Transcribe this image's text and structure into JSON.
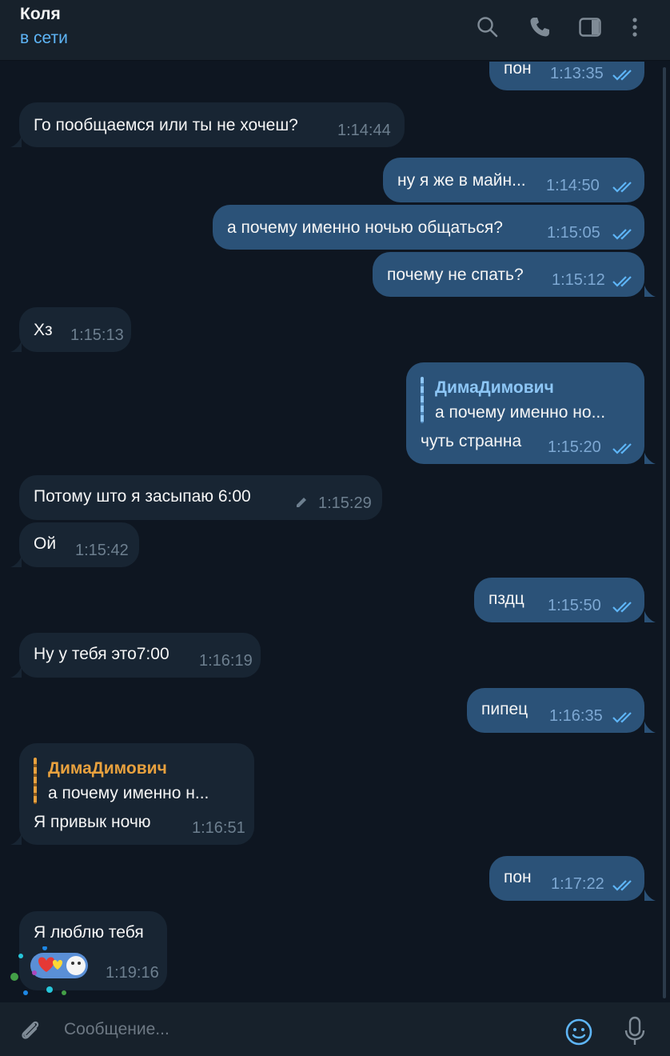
{
  "header": {
    "contact_name": "Коля",
    "status": "в сети",
    "icons": [
      "search-icon",
      "phone-icon",
      "sidebar-toggle-icon",
      "more-vertical-icon"
    ]
  },
  "messages": [
    {
      "dir": "out",
      "text": "пон",
      "time": "1:13:35",
      "read": true
    },
    {
      "dir": "in",
      "text": "Го пообщаемся или ты не хочеш?",
      "time": "1:14:44"
    },
    {
      "dir": "out",
      "text": "ну я же в майн...",
      "time": "1:14:50",
      "read": true
    },
    {
      "dir": "out",
      "text": "а почему именно ночью общаться?",
      "time": "1:15:05",
      "read": true
    },
    {
      "dir": "out",
      "text": "почему не спать?",
      "time": "1:15:12",
      "read": true
    },
    {
      "dir": "in",
      "text": "Хз",
      "time": "1:15:13"
    },
    {
      "dir": "out",
      "reply": {
        "name": "ДимаДимович",
        "text": "а почему именно но..."
      },
      "text": "чуть странна",
      "time": "1:15:20",
      "read": true
    },
    {
      "dir": "in",
      "text": "Потому што я засыпаю 6:00",
      "time": "1:15:29",
      "edited_icon": "pencil-icon"
    },
    {
      "dir": "in",
      "text": "Ой",
      "time": "1:15:42"
    },
    {
      "dir": "out",
      "text": "пздц",
      "time": "1:15:50",
      "read": true
    },
    {
      "dir": "in",
      "text": "Ну у тебя это7:00",
      "time": "1:16:19"
    },
    {
      "dir": "out",
      "text": "пипец",
      "time": "1:16:35",
      "read": true
    },
    {
      "dir": "in",
      "reply": {
        "name": "ДимаДимович",
        "text": "а почему именно н..."
      },
      "text": "Я привык ночю",
      "time": "1:16:51"
    },
    {
      "dir": "out",
      "text": "пон",
      "time": "1:17:22",
      "read": true
    },
    {
      "dir": "in",
      "text": "Я люблю тебя",
      "sticker": "hearts-sticker",
      "time": "1:19:16"
    }
  ],
  "composer": {
    "placeholder": "Сообщение...",
    "icons": [
      "attach-icon",
      "emoji-icon",
      "microphone-icon"
    ]
  },
  "colors": {
    "background": "#0e1621",
    "header": "#17212b",
    "incoming_bubble": "#182533",
    "outgoing_bubble": "#2b5278",
    "accent_blue": "#5eb5f7",
    "reply_name_in": "#e8a13e",
    "reply_name_out": "#8dc6f5"
  }
}
